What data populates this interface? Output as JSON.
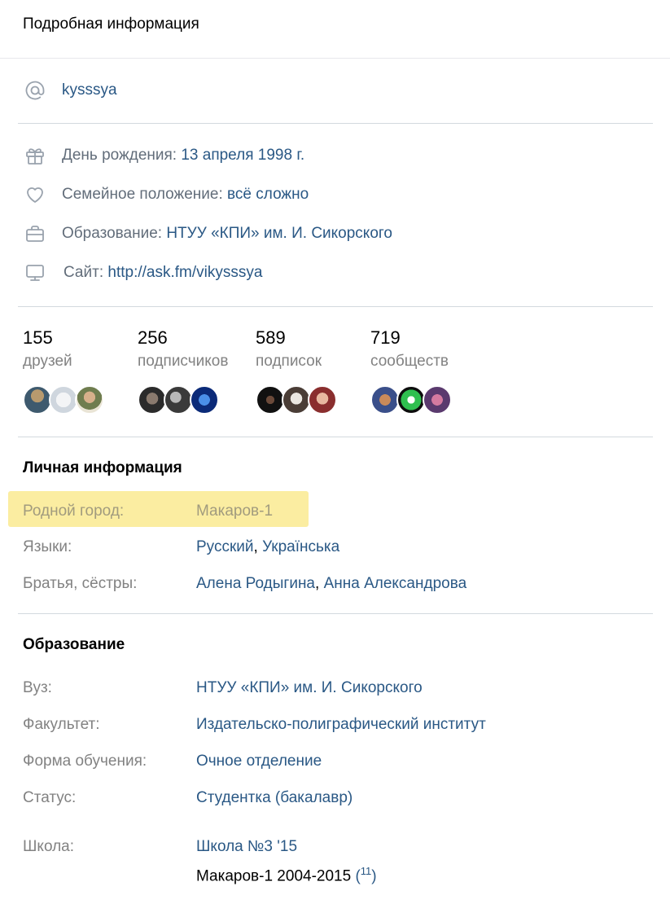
{
  "header": {
    "title": "Подробная информация"
  },
  "contacts": {
    "username": "kysssya",
    "birthday": {
      "label": "День рождения:",
      "value": "13 апреля 1998 г."
    },
    "relationship": {
      "label": "Семейное положение:",
      "value": "всё сложно"
    },
    "education": {
      "label": "Образование:",
      "value": "НТУУ «КПИ» им. И. Сикорского"
    },
    "site": {
      "label": "Сайт:",
      "value": "http://ask.fm/vikysssya"
    }
  },
  "counters": [
    {
      "count": "155",
      "label": "друзей"
    },
    {
      "count": "256",
      "label": "подписчиков"
    },
    {
      "count": "589",
      "label": "подписок"
    },
    {
      "count": "719",
      "label": "сообществ"
    }
  ],
  "personal": {
    "title": "Личная информация",
    "hometown": {
      "label": "Родной город:",
      "value": "Макаров-1"
    },
    "languages": {
      "label": "Языки:",
      "values": [
        "Русский",
        "Українська"
      ]
    },
    "siblings": {
      "label": "Братья, сёстры:",
      "values": [
        "Алена Родыгина",
        "Анна Александрова"
      ]
    },
    "separator": ","
  },
  "education_section": {
    "title": "Образование",
    "university": {
      "label": "Вуз:",
      "value": "НТУУ «КПИ» им. И. Сикорского"
    },
    "faculty": {
      "label": "Факультет:",
      "value": "Издательско-полиграфический институт"
    },
    "form": {
      "label": "Форма обучения:",
      "value": "Очное отделение"
    },
    "status": {
      "label": "Статус:",
      "value": "Студентка (бакалавр)"
    },
    "school": {
      "label": "Школа:",
      "value": "Школа №3 '15",
      "details": "Макаров-1 2004-2015",
      "classmates_open": "(",
      "classmates_count": "11",
      "classmates_close": ")"
    }
  },
  "icons": [
    "at-icon",
    "gift-icon",
    "heart-icon",
    "briefcase-icon",
    "monitor-icon"
  ],
  "colors": {
    "link": "#2a5885",
    "label": "#828282",
    "highlight": "#fbeda1",
    "divider": "#d3d9de"
  }
}
